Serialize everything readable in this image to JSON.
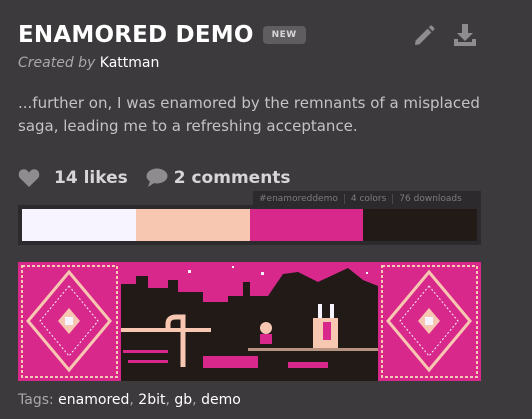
{
  "header": {
    "title": "ENAMORED DEMO",
    "badge": "NEW",
    "created_by_label": "Created by",
    "author": "Kattman",
    "edit_icon": "pencil-icon",
    "download_icon": "download-icon"
  },
  "description": "...further on, I was enamored by the remnants of a misplaced saga, leading me to a refreshing acceptance.",
  "stats": {
    "likes": "14 likes",
    "comments": "2 comments"
  },
  "palette": {
    "hashtag": "#enamoreddemo",
    "colors_count": "4 colors",
    "downloads": "76 downloads",
    "colors": [
      "#f7f3ff",
      "#f8c7b1",
      "#d9288b",
      "#211a17"
    ]
  },
  "tags": {
    "label": "Tags:",
    "items": [
      "enamored",
      "2bit",
      "gb",
      "demo"
    ]
  }
}
